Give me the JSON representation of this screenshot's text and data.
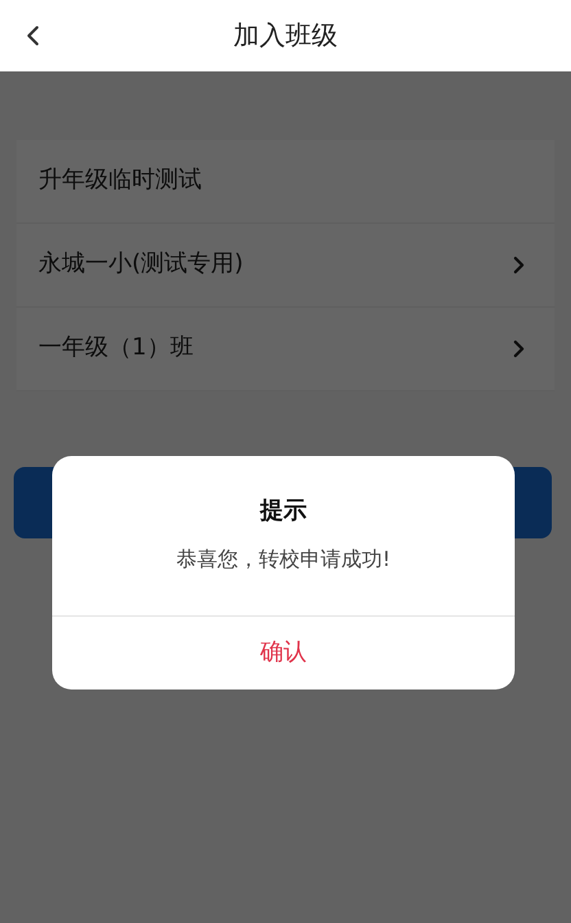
{
  "header": {
    "title": "加入班级"
  },
  "rows": [
    {
      "label": "升年级临时测试",
      "kind": "plain"
    },
    {
      "label": "永城一小(测试专用)",
      "kind": "link"
    },
    {
      "label": "一年级（1）班",
      "kind": "link"
    }
  ],
  "dialog": {
    "title": "提示",
    "message": "恭喜您，转校申请成功!",
    "confirm": "确认"
  }
}
